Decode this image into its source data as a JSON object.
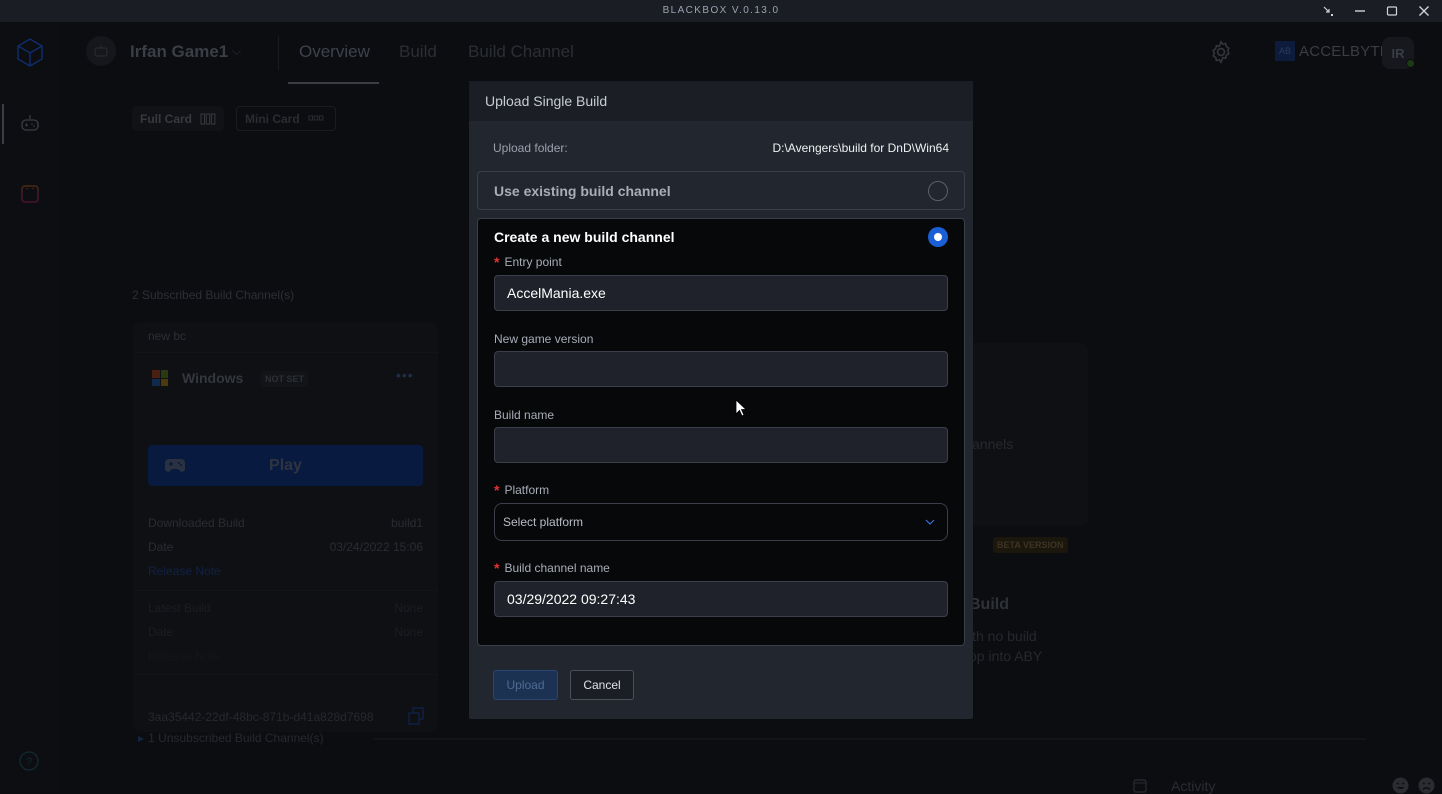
{
  "window": {
    "title": "BLACKBOX V.0.13.0",
    "controls": [
      "restore-small",
      "minimize",
      "maximize",
      "close"
    ]
  },
  "header": {
    "game_name": "Irfan Game1",
    "tabs": [
      {
        "label": "Overview",
        "active": true
      },
      {
        "label": "Build",
        "active": false
      },
      {
        "label": "Build Channel",
        "active": false
      }
    ],
    "brand": "ACCELBYTE",
    "brand_mark": "AB",
    "avatar_initials": "IR",
    "online_status_color": "#3aa62b"
  },
  "sidebar": {
    "items": [
      {
        "icon": "cube-logo-icon"
      },
      {
        "icon": "gamepad-icon",
        "active": true
      },
      {
        "icon": "calendar-icon"
      }
    ],
    "help_icon": "help-circle-icon"
  },
  "view_toggle": {
    "full_card": "Full Card",
    "mini_card": "Mini Card"
  },
  "subscribed": {
    "count_label": "2 Subscribed Build Channel(s)",
    "card": {
      "channel_name": "new bc",
      "platform": "Windows",
      "platform_badge": "NOT SET",
      "play_label": "Play",
      "downloaded_build_label": "Downloaded Build",
      "downloaded_build_value": "build1",
      "date_label": "Date",
      "date_value": "03/24/2022 15:06",
      "release_note_label": "Release Note",
      "latest_build_label": "Latest Build",
      "latest_build_value": "None",
      "latest_date_label": "Date",
      "latest_date_value": "None",
      "latest_release_note_label": "Release Note",
      "uuid": "3aa35442-22df-48bc-871b-d41a828d7698"
    }
  },
  "right_panel": {
    "channels_fragment": "annels",
    "beta_badge": "BETA VERSION",
    "title_fragment": "Build",
    "line1_fragment": "ith no build",
    "line2_fragment": "op into ABY"
  },
  "unsubscribed": {
    "label": "1 Unsubscribed Build Channel(s)"
  },
  "footer": {
    "activity_label": "Activity"
  },
  "modal": {
    "title": "Upload Single Build",
    "upload_folder_label": "Upload folder:",
    "upload_folder_value": "D:\\Avengers\\build for DnD\\Win64",
    "option_existing": {
      "label": "Use existing build channel",
      "selected": false
    },
    "option_new": {
      "label": "Create a new build channel",
      "selected": true
    },
    "fields": {
      "entry_point": {
        "label": "Entry point",
        "required": true,
        "value": "AccelMania.exe"
      },
      "game_version": {
        "label": "New game version",
        "required": false,
        "value": ""
      },
      "build_name": {
        "label": "Build name",
        "required": false,
        "value": ""
      },
      "platform": {
        "label": "Platform",
        "required": true,
        "placeholder": "Select platform"
      },
      "build_channel_name": {
        "label": "Build channel name",
        "required": true,
        "value": "03/29/2022 09:27:43"
      }
    },
    "upload_label": "Upload",
    "cancel_label": "Cancel",
    "accent_color": "#1a5fd6",
    "required_color": "#e03434"
  }
}
